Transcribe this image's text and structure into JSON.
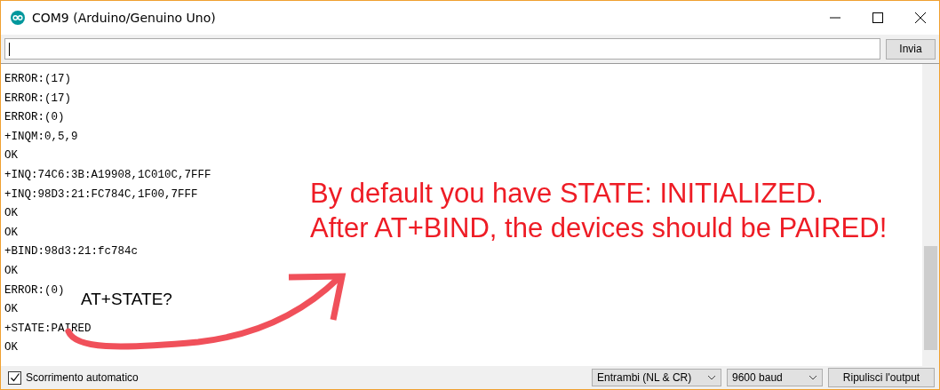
{
  "window": {
    "title": "COM9 (Arduino/Genuino Uno)"
  },
  "send": {
    "button": "Invia"
  },
  "output": {
    "lines": [
      "ERROR:(17)",
      "ERROR:(17)",
      "ERROR:(0)",
      "+INQM:0,5,9",
      "OK",
      "+INQ:74C6:3B:A19908,1C010C,7FFF",
      "+INQ:98D3:21:FC784C,1F00,7FFF",
      "OK",
      "OK",
      "+BIND:98d3:21:fc784c",
      "OK",
      "ERROR:(0)",
      "OK",
      "+STATE:PAIRED",
      "OK"
    ]
  },
  "annotations": [
    {
      "kind": "headline",
      "lines": [
        "By default you have STATE: INITIALIZED.",
        "After AT+BIND, the devices should be PAIRED!"
      ]
    },
    {
      "kind": "label",
      "lines": [
        "AT+STATE?"
      ]
    }
  ],
  "footer": {
    "autoscroll": {
      "label": "Scorrimento automatico",
      "checked": true
    },
    "line_ending": "Entrambi (NL & CR)",
    "baud": "9600 baud",
    "clear_button": "Ripulisci l'output"
  }
}
